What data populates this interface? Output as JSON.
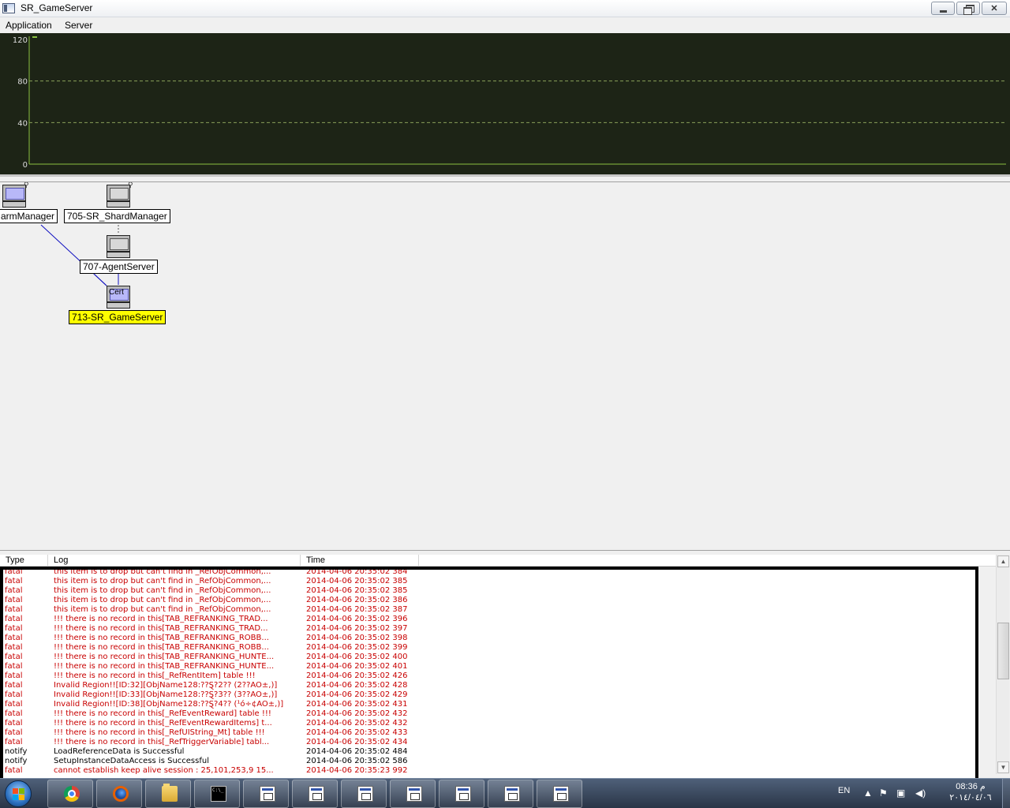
{
  "window": {
    "title": "SR_GameServer"
  },
  "menu": {
    "items": [
      "Application",
      "Server"
    ]
  },
  "chart_data": {
    "type": "line",
    "title": "",
    "xlabel": "",
    "ylabel": "",
    "yticks": [
      "120",
      "80",
      "40",
      "0"
    ],
    "ylim": [
      0,
      120
    ],
    "grid": "dashed horizontal at 40 and 80",
    "series": [
      {
        "values": [
          0
        ]
      }
    ],
    "colors": {
      "background": "#1d2416",
      "grid": "#8aa05a",
      "line": "#8ac040",
      "axis": "#8ac040"
    }
  },
  "topology": {
    "nodes": [
      {
        "label": "armManager",
        "icon": "computer-icon"
      },
      {
        "label": "705-SR_ShardManager",
        "icon": "computer-icon"
      },
      {
        "label": "707-AgentServer",
        "icon": "computer-icon"
      },
      {
        "label": "713-SR_GameServer",
        "icon": "computer-icon",
        "icon_text": "Cert",
        "selected": true
      }
    ]
  },
  "log": {
    "columns": [
      "Type",
      "Log",
      "Time"
    ],
    "rows": [
      {
        "type": "fatal",
        "log": "this item is to drop but can't find in _RefObjCommon,...",
        "time": "2014-04-06 20:35:02 384"
      },
      {
        "type": "fatal",
        "log": "this item is to drop but can't find in _RefObjCommon,...",
        "time": "2014-04-06 20:35:02 385"
      },
      {
        "type": "fatal",
        "log": "this item is to drop but can't find in _RefObjCommon,...",
        "time": "2014-04-06 20:35:02 385"
      },
      {
        "type": "fatal",
        "log": "this item is to drop but can't find in _RefObjCommon,...",
        "time": "2014-04-06 20:35:02 386"
      },
      {
        "type": "fatal",
        "log": "this item is to drop but can't find in _RefObjCommon,...",
        "time": "2014-04-06 20:35:02 387"
      },
      {
        "type": "fatal",
        "log": "!!! there is no record in this[TAB_REFRANKING_TRAD...",
        "time": "2014-04-06 20:35:02 396"
      },
      {
        "type": "fatal",
        "log": "!!! there is no record in this[TAB_REFRANKING_TRAD...",
        "time": "2014-04-06 20:35:02 397"
      },
      {
        "type": "fatal",
        "log": "!!! there is no record in this[TAB_REFRANKING_ROBB...",
        "time": "2014-04-06 20:35:02 398"
      },
      {
        "type": "fatal",
        "log": "!!! there is no record in this[TAB_REFRANKING_ROBB...",
        "time": "2014-04-06 20:35:02 399"
      },
      {
        "type": "fatal",
        "log": "!!! there is no record in this[TAB_REFRANKING_HUNTE...",
        "time": "2014-04-06 20:35:02 400"
      },
      {
        "type": "fatal",
        "log": "!!! there is no record in this[TAB_REFRANKING_HUNTE...",
        "time": "2014-04-06 20:35:02 401"
      },
      {
        "type": "fatal",
        "log": "!!! there is no record in this[_RefRentItem] table !!!",
        "time": "2014-04-06 20:35:02 426"
      },
      {
        "type": "fatal",
        "log": "Invalid Region!![ID:32][ObjName128:??Ȿ?2?? (2??AO±,)]",
        "time": "2014-04-06 20:35:02 428"
      },
      {
        "type": "fatal",
        "log": "Invalid Region!![ID:33][ObjName128:??Ȿ?3?? (3??AO±,)]",
        "time": "2014-04-06 20:35:02 429"
      },
      {
        "type": "fatal",
        "log": "Invalid Region!![ID:38][ObjName128:??Ȿ?4?? (¹ó÷¢AO±,)]",
        "time": "2014-04-06 20:35:02 431"
      },
      {
        "type": "fatal",
        "log": "!!! there is no record in this[_RefEventReward] table !!!",
        "time": "2014-04-06 20:35:02 432"
      },
      {
        "type": "fatal",
        "log": "!!! there is no record in this[_RefEventRewardItems] t...",
        "time": "2014-04-06 20:35:02 432"
      },
      {
        "type": "fatal",
        "log": "!!! there is no record in this[_RefUIString_Mt] table !!!",
        "time": "2014-04-06 20:35:02 433"
      },
      {
        "type": "fatal",
        "log": "!!! there is no record in this[_RefTriggerVariable] tabl...",
        "time": "2014-04-06 20:35:02 434"
      },
      {
        "type": "notify",
        "log": "LoadReferenceData is Successful",
        "time": "2014-04-06 20:35:02 484"
      },
      {
        "type": "notify",
        "log": "SetupInstanceDataAccess is Successful",
        "time": "2014-04-06 20:35:02 586"
      },
      {
        "type": "fatal",
        "log": "cannot establish keep alive session : 25,101,253,9 15...",
        "time": "2014-04-06 20:35:23 992"
      }
    ],
    "colors": {
      "fatal": "#c80000",
      "notify": "#000000"
    }
  },
  "taskbar": {
    "items": [
      {
        "name": "chrome-icon"
      },
      {
        "name": "firefox-icon"
      },
      {
        "name": "explorer-icon"
      },
      {
        "name": "cmd-icon",
        "label": "C:\\_"
      },
      {
        "name": "app-icon"
      },
      {
        "name": "app-icon"
      },
      {
        "name": "app-icon"
      },
      {
        "name": "app-icon"
      },
      {
        "name": "app-icon"
      },
      {
        "name": "app-icon"
      },
      {
        "name": "app-icon"
      }
    ],
    "tray": {
      "language": "EN",
      "time": "08:36 م",
      "date": "٢٠١٤/٠٤/٠٦"
    }
  }
}
